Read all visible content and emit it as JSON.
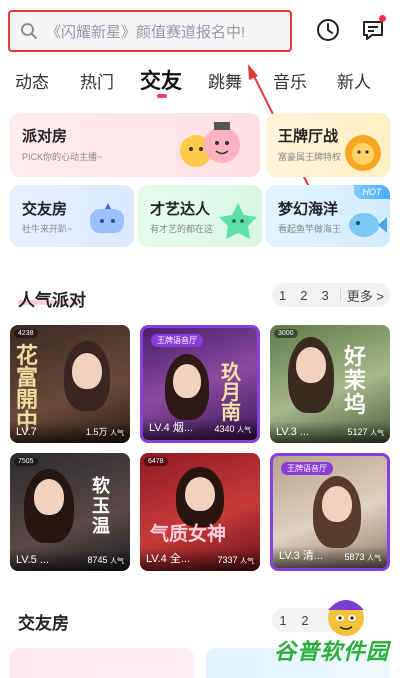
{
  "search": {
    "placeholder": "《闪耀新星》颜值赛道报名中!"
  },
  "tabs": [
    "动态",
    "热门",
    "交友",
    "跳舞",
    "音乐",
    "新人"
  ],
  "active_tab": "交友",
  "categories": [
    {
      "title": "派对房",
      "subtitle": "PICK你的心动主播~"
    },
    {
      "title": "王牌厅战",
      "subtitle": "富豪属王牌特权"
    },
    {
      "title": "交友房",
      "subtitle": "社牛来开趴~"
    },
    {
      "title": "才艺达人",
      "subtitle": "有才艺的都在这"
    },
    {
      "title": "梦幻海洋",
      "subtitle": "看起鱼竿做海王",
      "badge": "HOT"
    }
  ],
  "popular": {
    "title": "人气派对",
    "pages": [
      "1",
      "2",
      "3"
    ],
    "more": "更多 >",
    "rooms": [
      {
        "level": "LV.7",
        "pop": "1.5万",
        "unit": "人气",
        "tag": "",
        "art": "花 富 開 中",
        "id": "4238"
      },
      {
        "level": "LV.4 烟...",
        "pop": "4340",
        "unit": "人气",
        "tag": "王牌语音厅",
        "art": "玖 月 南",
        "id": ""
      },
      {
        "level": "LV.3 ...",
        "pop": "5127",
        "unit": "人气",
        "tag": "",
        "art": "好 茉 坞",
        "id": "3000"
      },
      {
        "level": "LV.5 ...",
        "pop": "8745",
        "unit": "人气",
        "tag": "",
        "art": "软 玉 温",
        "id": "7505"
      },
      {
        "level": "LV.4 全...",
        "pop": "7337",
        "unit": "人气",
        "tag": "",
        "art": "气质女神",
        "id": "6478"
      },
      {
        "level": "LV.3 清...",
        "pop": "5873",
        "unit": "人气",
        "tag": "王牌语音厅",
        "art": "",
        "id": ""
      }
    ]
  },
  "friends": {
    "title": "交友房",
    "pages": [
      "1",
      "2"
    ]
  },
  "watermark": "谷普软件园",
  "colors": {
    "accent_pink": "#ff3a7a",
    "highlight_red": "#e53935",
    "purple_frame": "#8a3fe0"
  }
}
